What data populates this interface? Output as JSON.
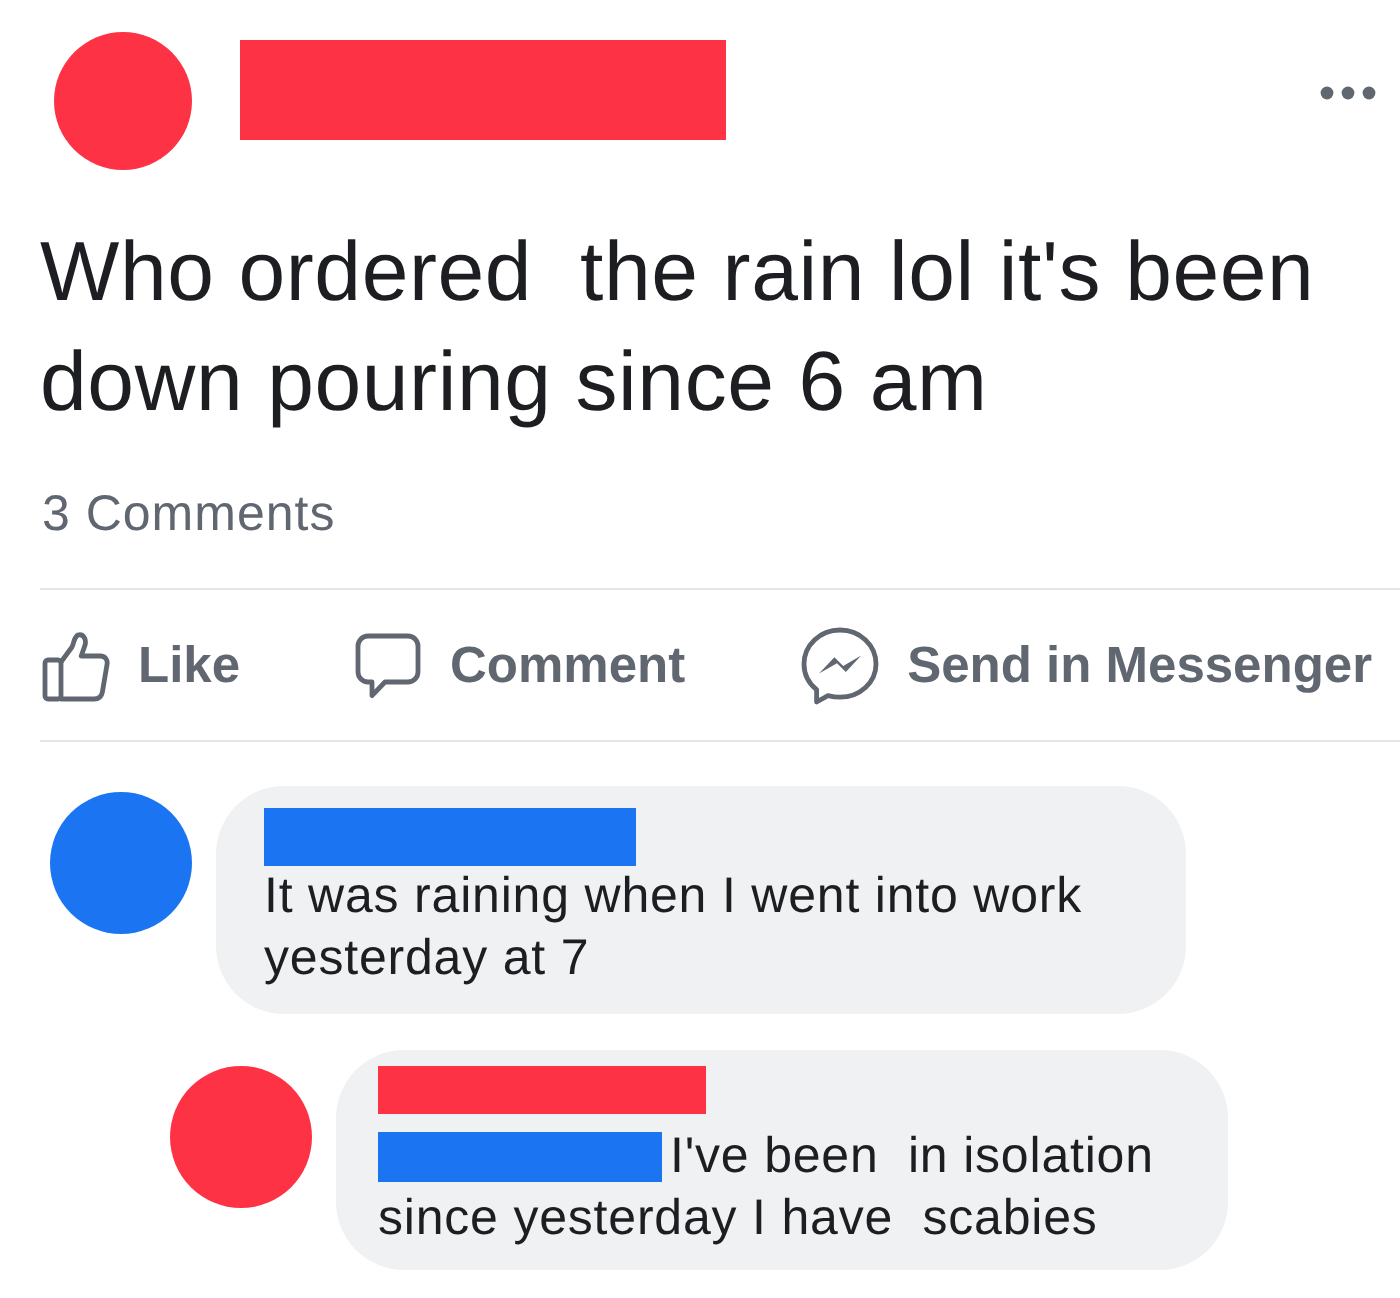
{
  "post": {
    "text": "Who ordered  the rain lol it's been down pouring since 6 am",
    "comment_count": "3 Comments"
  },
  "actions": [
    {
      "kind": "like",
      "label": "Like"
    },
    {
      "kind": "comment",
      "label": "Comment"
    },
    {
      "kind": "messenger",
      "label": "Send in Messenger"
    }
  ],
  "comments": [
    {
      "color": "#1b75f3",
      "text": "It was raining when I went into work yesterday at 7",
      "children": [
        {
          "color": "#fd3245",
          "mention": true,
          "text": "I've been  in isolation since yesterday I have  scabies"
        }
      ]
    }
  ]
}
